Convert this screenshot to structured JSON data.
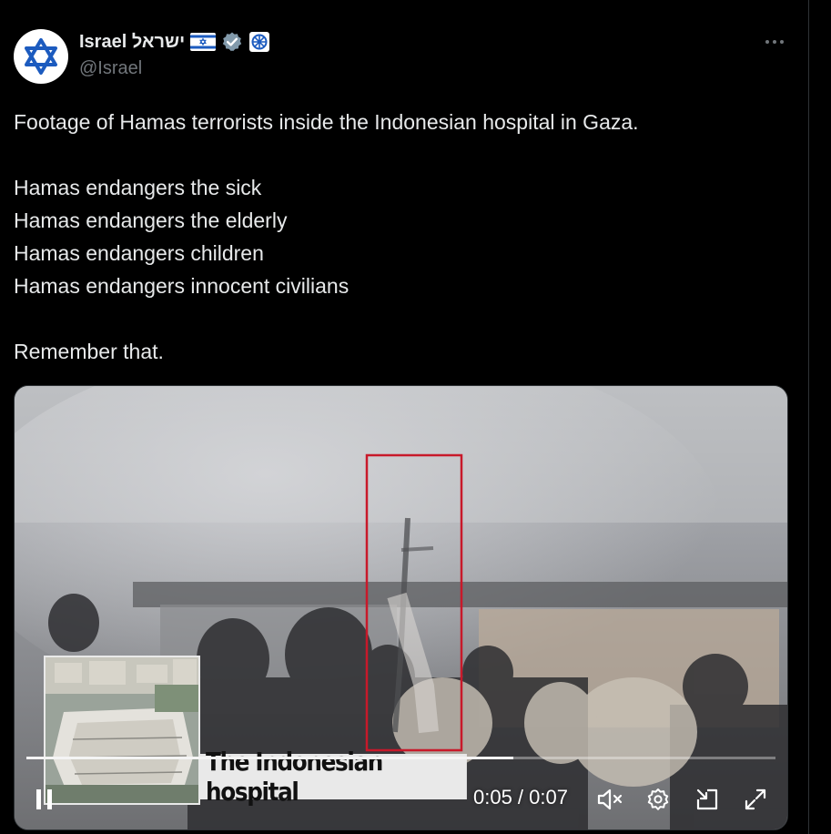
{
  "author": {
    "display_name": "Israel ישראל",
    "handle": "@Israel"
  },
  "tweet": {
    "lines": [
      "Footage of Hamas terrorists inside the Indonesian hospital in Gaza.",
      "",
      "Hamas endangers the sick",
      "Hamas endangers the elderly",
      "Hamas endangers children",
      "Hamas endangers innocent civilians",
      "",
      "Remember that."
    ]
  },
  "video": {
    "caption": "The Indonesian hospital",
    "time": "0:05 / 0:07",
    "progress_fraction": 0.65
  },
  "icons": {
    "avatar": "star-of-david-icon",
    "flag": "israel-flag-icon",
    "verified": "verified-badge-icon",
    "affiliate": "affiliate-emblem-icon",
    "more": "more-icon",
    "pause": "pause-icon",
    "mute": "mute-icon",
    "settings": "settings-icon",
    "pip": "picture-in-picture-icon",
    "fullscreen": "fullscreen-icon"
  },
  "colors": {
    "background": "#000000",
    "text": "#e7e9ea",
    "secondary_text": "#71767b",
    "israel_blue": "#1c5bbf",
    "highlight_box": "#c8192a"
  }
}
